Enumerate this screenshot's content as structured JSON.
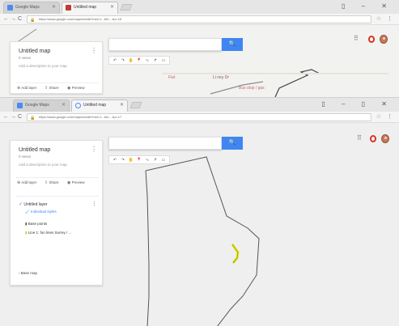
{
  "browser": {
    "top_window": {
      "tabs": [
        {
          "label": "Google Maps",
          "active": false,
          "favicon_color": "#4a8af4"
        },
        {
          "label": "Untitled map",
          "active": true,
          "favicon_color": "#c33b32"
        }
      ],
      "url": "https://www.google.com/maps/d/edit?mid=1...&ll=...&z=15",
      "window_controls": "▯ – ✕"
    },
    "bottom_window": {
      "tabs": [
        {
          "label": "Google Maps",
          "active": false,
          "favicon_color": "#4a8af4"
        },
        {
          "label": "Untitled map",
          "active": true,
          "favicon_color": "#4a8af4"
        }
      ],
      "url": "https://www.google.com/maps/d/edit?mid=1...&ll=...&z=17",
      "window_controls": "▯ – ▯ ✕"
    },
    "nav": {
      "back": "←",
      "forward": "→",
      "reload": "C",
      "star": "☆",
      "menu": "⋮",
      "lock": "🔒"
    }
  },
  "map_panel": {
    "title": "Untitled map",
    "views": "0 views",
    "description": "Add a description to your map",
    "kebab": "⋮",
    "actions": [
      {
        "icon": "add-layer-icon",
        "glyph": "⊕",
        "label": "Add layer"
      },
      {
        "icon": "share-icon",
        "glyph": "⇪",
        "label": "Share"
      },
      {
        "icon": "preview-icon",
        "glyph": "◉",
        "label": "Preview"
      }
    ],
    "layer": {
      "title": "Untitled layer",
      "style": "Individual styles",
      "base_item": "Base points",
      "line_item": "Line 1: fun lines Surrey / ...",
      "basemap": "Base map"
    }
  },
  "search": {
    "placeholder": "",
    "button_glyph": "🔍"
  },
  "toolbar": {
    "tools": [
      {
        "name": "undo",
        "glyph": "↶"
      },
      {
        "name": "redo",
        "glyph": "↷"
      },
      {
        "name": "hand",
        "glyph": "✋"
      },
      {
        "name": "marker",
        "glyph": "📍"
      },
      {
        "name": "line",
        "glyph": "∿"
      },
      {
        "name": "directions",
        "glyph": "↱"
      },
      {
        "name": "ruler",
        "glyph": "▭"
      }
    ]
  },
  "header_icons": {
    "apps": "⠿"
  },
  "map_labels": {
    "label_a": "Fiat",
    "label_b": "Li ney Dr",
    "label_c": "Bus stop / gas"
  },
  "colors": {
    "accent": "#3f86f3",
    "polygon_stroke": "#555555",
    "marker": "#e2e21a"
  }
}
